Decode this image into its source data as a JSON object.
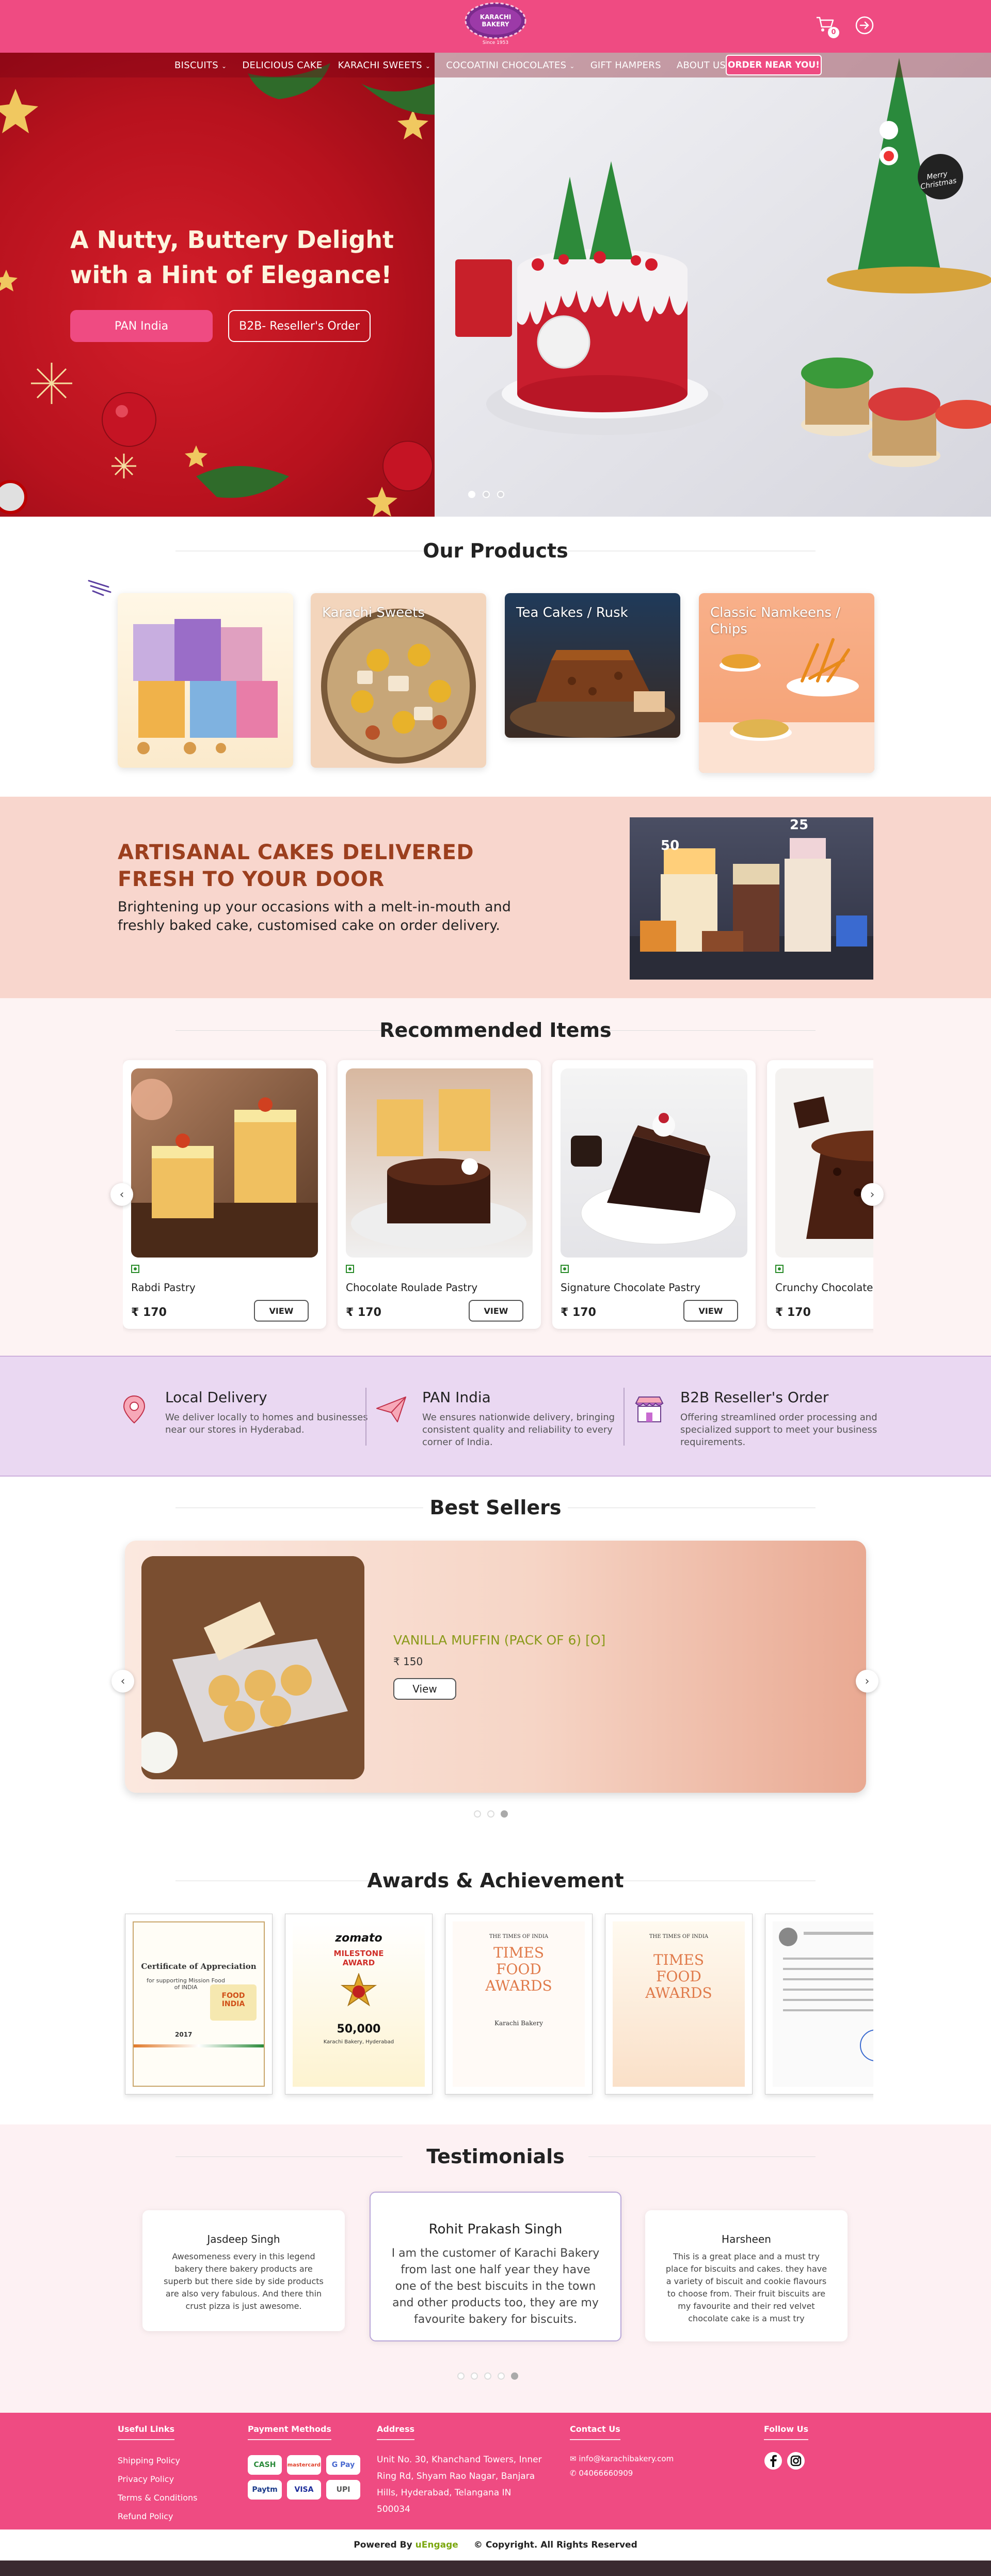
{
  "header": {
    "logo_text": "KARACHI BAKERY",
    "logo_tagline": "Since 1953",
    "cart_count": "0",
    "nav": [
      "BISCUITS",
      "DELICIOUS CAKE",
      "KARACHI SWEETS",
      "COCOATINI CHOCOLATES",
      "GIFT HAMPERS",
      "ABOUT US"
    ],
    "order_button": "ORDER NEAR YOU!"
  },
  "hero": {
    "title": "A Nutty, Buttery Delight with a Hint of Elegance!",
    "btn_pan": "PAN India",
    "btn_b2b": "B2B- Reseller's Order",
    "cake_sign": "Merry Christmas",
    "slides": 3,
    "active_slide": 1
  },
  "products": {
    "title": "Our Products",
    "items": [
      "",
      "Karachi Sweets",
      "Tea Cakes / Rusk",
      "Classic Namkeens / Chips"
    ]
  },
  "artisan": {
    "title": "ARTISANAL CAKES DELIVERED FRESH TO YOUR DOOR",
    "subtitle": "Brightening up your occasions with a melt-in-mouth and freshly baked cake, customised cake on order delivery.",
    "cake_numbers": [
      "50",
      "25"
    ]
  },
  "recommended": {
    "title": "Recommended Items",
    "view_label": "VIEW",
    "items": [
      {
        "name": "Rabdi Pastry",
        "price": "₹ 170"
      },
      {
        "name": "Chocolate Roulade Pastry",
        "price": "₹ 170"
      },
      {
        "name": "Signature Chocolate Pastry",
        "price": "₹ 170"
      },
      {
        "name": "Crunchy Chocolate",
        "price": "₹ 170"
      }
    ]
  },
  "features": [
    {
      "title": "Local Delivery",
      "desc": "We deliver locally to homes and businesses near our stores in Hyderabad."
    },
    {
      "title": "PAN India",
      "desc": "We ensures nationwide delivery, bringing consistent quality and reliability to every corner of India."
    },
    {
      "title": "B2B Reseller's Order",
      "desc": "Offering streamlined order processing and specialized support to meet your business requirements."
    }
  ],
  "bestsellers": {
    "title": "Best Sellers",
    "name": "VANILLA MUFFIN (PACK OF 6) [O]",
    "price": "₹ 150",
    "view": "View",
    "pages": 3,
    "active_page": 3
  },
  "awards": {
    "title": "Awards & Achievement",
    "a1": {
      "heading": "Certificate of Appreciation",
      "line": "for supporting Mission Food of INDIA",
      "badge": "FOOD INDIA",
      "year": "2017"
    },
    "a2": {
      "brand": "zomato",
      "heading": "MILESTONE AWARD",
      "number": "50,000",
      "sub": "Karachi Bakery, Hyderabad"
    },
    "a3": {
      "paper": "THE TIMES OF INDIA",
      "heading": "TIMES FOOD AWARDS",
      "sub": "Karachi Bakery"
    },
    "a4": {
      "paper": "THE TIMES OF INDIA",
      "heading": "TIMES FOOD AWARDS"
    }
  },
  "testimonials": {
    "title": "Testimonials",
    "items": [
      {
        "name": "Jasdeep Singh",
        "text": "Awesomeness every in this legend bakery there bakery products are superb but there side by side products are also very fabulous. And there thin crust pizza is just awesome."
      },
      {
        "name": "Rohit Prakash Singh",
        "text": "I am the customer of Karachi Bakery from last one half year they have one of the best biscuits in the town and other products too, they are my favourite bakery for biscuits."
      },
      {
        "name": "Harsheen",
        "text": "This is a great place and a must try place for biscuits and cakes. they have a variety of biscuit and cookie flavours to choose from. Their fruit biscuits are my favourite and their red velvet chocolate cake is a must try"
      }
    ],
    "pages": 5,
    "active_page": 5
  },
  "footer": {
    "useful_links": {
      "title": "Useful Links",
      "links": [
        "Shipping Policy",
        "Privacy Policy",
        "Terms & Conditions",
        "Refund Policy"
      ]
    },
    "payment": {
      "title": "Payment Methods",
      "methods": [
        "CASH",
        "mastercard",
        "G Pay",
        "Paytm",
        "VISA",
        "UPI"
      ]
    },
    "address": {
      "title": "Address",
      "text": "Unit No. 30, Khanchand Towers, Inner Ring Rd, Shyam Rao Nagar, Banjara Hills, Hyderabad, Telangana IN 500034"
    },
    "contact": {
      "title": "Contact Us",
      "email": "info@karachibakery.com",
      "phone": "04066660909"
    },
    "follow": {
      "title": "Follow Us"
    },
    "powered_by": "Powered By",
    "powered_brand": "uEngage",
    "copyright": "Copyright. All Rights Reserved"
  },
  "colors": {
    "brand": "#ef4b82",
    "artisan_bg": "#f8d6cd",
    "feature_bg": "#ead8f2",
    "testimonial_bg": "#fdf1f3"
  }
}
